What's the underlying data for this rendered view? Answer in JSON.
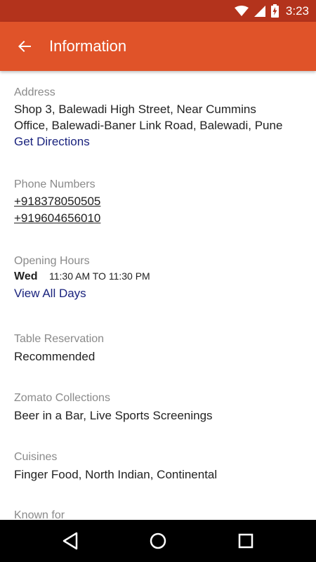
{
  "status_bar": {
    "time": "3:23"
  },
  "app_bar": {
    "title": "Information"
  },
  "address": {
    "label": "Address",
    "line1": "Shop 3, Balewadi High Street, Near Cummins",
    "line2": "Office, Balewadi-Baner Link Road, Balewadi, Pune",
    "directions_link": "Get Directions"
  },
  "phones": {
    "label": "Phone Numbers",
    "numbers": [
      "+918378050505",
      "+919604656010"
    ]
  },
  "opening_hours": {
    "label": "Opening Hours",
    "day": "Wed",
    "hours": "11:30 AM TO 11:30 PM",
    "view_all": "View All Days"
  },
  "table_reservation": {
    "label": "Table Reservation",
    "value": "Recommended"
  },
  "collections": {
    "label": "Zomato Collections",
    "value": "Beer in a Bar, Live Sports Screenings"
  },
  "cuisines": {
    "label": "Cuisines",
    "value": "Finger Food, North Indian, Continental"
  },
  "known_for": {
    "label": "Known for"
  },
  "colors": {
    "status_bar": "#b3331c",
    "app_bar": "#e05329",
    "link": "#1a237e"
  }
}
